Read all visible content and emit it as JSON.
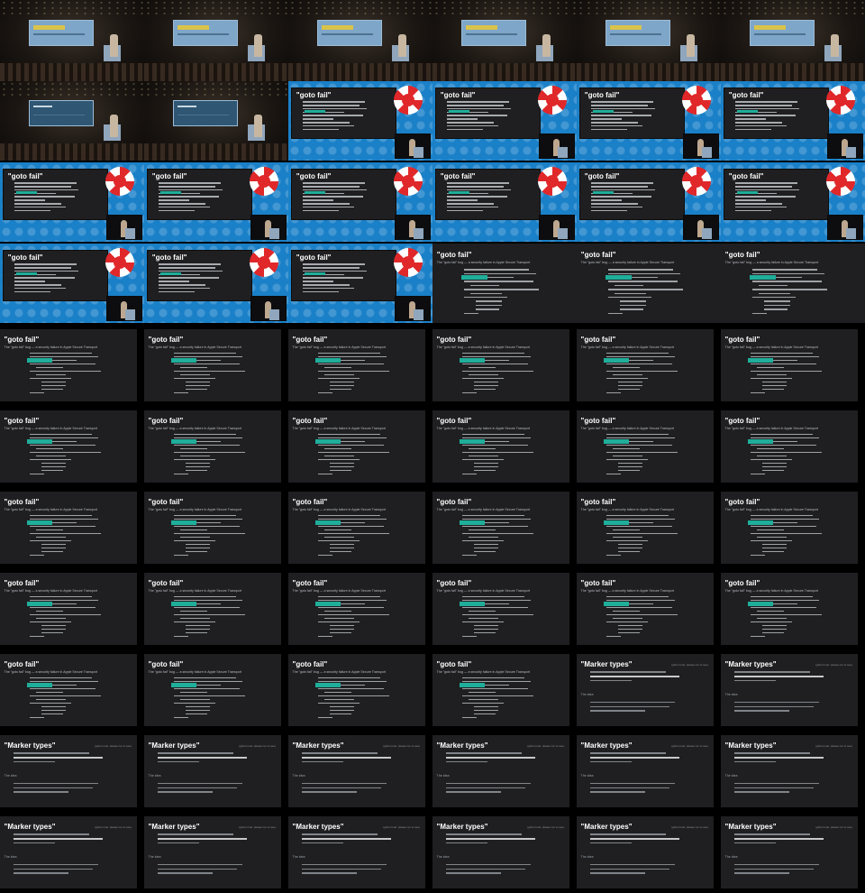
{
  "contact_sheet": {
    "columns": 6,
    "rows": 11,
    "text": {
      "goto_title": "\"goto fail\"",
      "goto_subtitle": "The \"goto fail\" bug — a security failure in Apple Secure Transport",
      "marker_title": "\"Marker types\"",
      "marker_note": "(ghost note: please run to see)",
      "marker_section": "The idea"
    },
    "tiles": [
      "stage",
      "stage",
      "stage",
      "stage",
      "stage",
      "stage",
      "stage-code",
      "stage-code",
      "blue",
      "blue",
      "blue",
      "blue",
      "blue",
      "blue",
      "blue",
      "blue",
      "blue",
      "blue",
      "blue",
      "blue",
      "blue",
      "slide-goto",
      "slide-goto",
      "slide-goto",
      "slide-goto",
      "slide-goto",
      "slide-goto",
      "slide-goto",
      "slide-goto",
      "slide-goto",
      "slide-goto",
      "slide-goto",
      "slide-goto",
      "slide-goto",
      "slide-goto",
      "slide-goto",
      "slide-goto",
      "slide-goto",
      "slide-goto",
      "slide-goto",
      "slide-goto",
      "slide-goto",
      "slide-goto",
      "slide-goto",
      "slide-goto",
      "slide-goto",
      "slide-goto",
      "slide-goto",
      "slide-goto",
      "slide-goto",
      "slide-goto",
      "slide-goto",
      "slide-marker",
      "slide-marker",
      "slide-marker",
      "slide-marker",
      "slide-marker",
      "slide-marker",
      "slide-marker",
      "slide-marker",
      "slide-marker",
      "slide-marker",
      "slide-marker",
      "slide-marker",
      "slide-marker",
      "slide-marker"
    ],
    "colors": {
      "background": "#000000",
      "blue_bg": "#1a80c8",
      "slide_bg": "#1f1f21",
      "highlight": "#1fae9a",
      "logo_red": "#e0282a"
    }
  }
}
